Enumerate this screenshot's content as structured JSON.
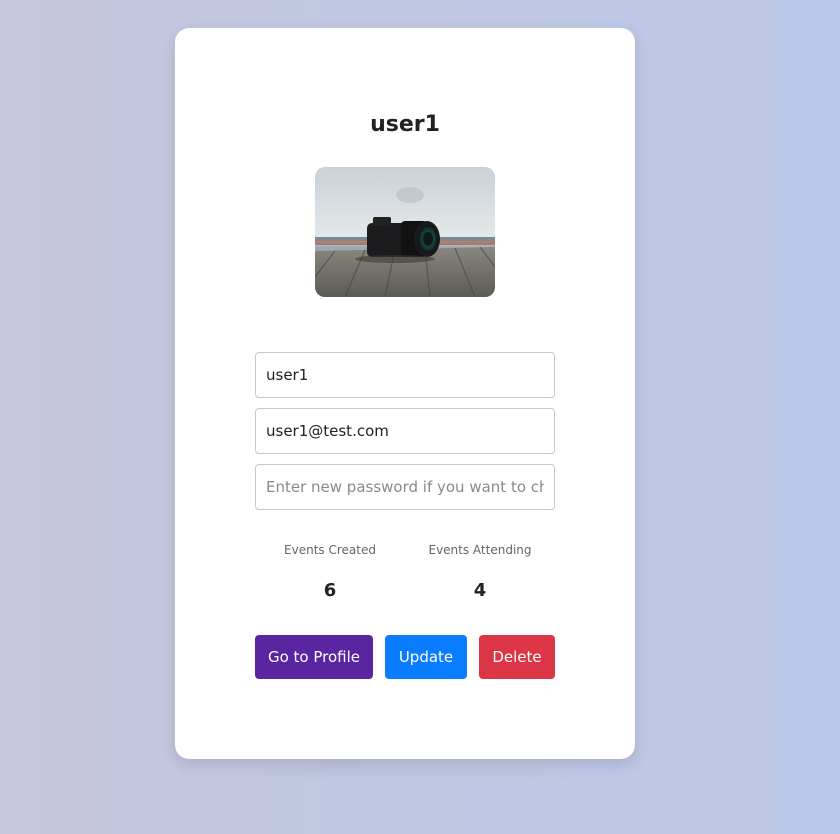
{
  "profile": {
    "title": "user1",
    "photo_alt": "camera-photo"
  },
  "form": {
    "username_value": "user1",
    "email_value": "user1@test.com",
    "password_value": "",
    "password_placeholder": "Enter new password if you want to change"
  },
  "stats": {
    "created_label": "Events Created",
    "created_value": "6",
    "attending_label": "Events Attending",
    "attending_value": "4"
  },
  "actions": {
    "profile_label": "Go to Profile",
    "update_label": "Update",
    "delete_label": "Delete"
  },
  "colors": {
    "profile_button": "#5b24a0",
    "update_button": "#0a7cff",
    "delete_button": "#dc3545"
  }
}
